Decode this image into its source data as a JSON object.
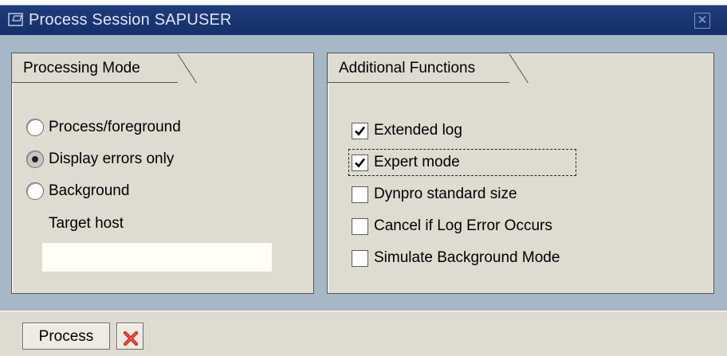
{
  "window": {
    "title": "Process Session SAPUSER",
    "close_icon": "close-icon"
  },
  "processing_mode": {
    "title": "Processing Mode",
    "options": [
      {
        "label": "Process/foreground",
        "selected": false
      },
      {
        "label": "Display errors only",
        "selected": true
      },
      {
        "label": "Background",
        "selected": false
      }
    ],
    "target_host_label": "Target host",
    "target_host_value": ""
  },
  "additional_functions": {
    "title": "Additional Functions",
    "options": [
      {
        "label": "Extended log",
        "checked": true
      },
      {
        "label": "Expert mode",
        "checked": true,
        "focused": true
      },
      {
        "label": "Dynpro standard size",
        "checked": false
      },
      {
        "label": "Cancel if Log Error Occurs",
        "checked": false
      },
      {
        "label": "Simulate Background Mode",
        "checked": false
      }
    ]
  },
  "footer": {
    "process_label": "Process",
    "cancel_icon": "cancel-x-icon",
    "cancel_color": "#d62020"
  }
}
